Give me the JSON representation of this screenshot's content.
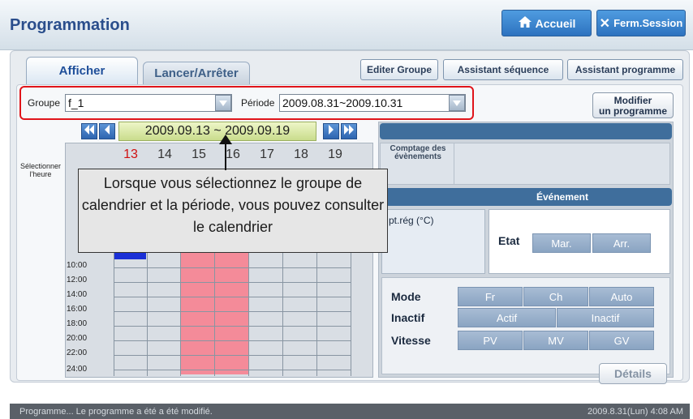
{
  "header": {
    "title": "Programmation",
    "home_label": "Accueil",
    "logout_label": "Ferm.Session"
  },
  "tabs": [
    {
      "label": "Afficher",
      "active": true
    },
    {
      "label": "Lancer/Arrêter",
      "active": false
    }
  ],
  "toolbar": {
    "edit_group": "Editer Groupe",
    "sequence_wizard": "Assistant séquence",
    "program_wizard": "Assistant programme"
  },
  "filter": {
    "group_label": "Groupe",
    "group_value": "f_1",
    "period_label": "Période",
    "period_value": "2009.08.31~2009.10.31",
    "modify_line1": "Modifier",
    "modify_line2": "un programme"
  },
  "calendar": {
    "date_range": "2009.09.13 ~ 2009.09.19",
    "days": [
      "13",
      "14",
      "15",
      "16",
      "17",
      "18",
      "19"
    ],
    "sunday_color": "#d01010",
    "select_time_line1": "Sélectionner",
    "select_time_line2": "l'heure",
    "times": [
      "10:00",
      "12:00",
      "14:00",
      "16:00",
      "18:00",
      "20:00",
      "22:00",
      "24:00"
    ]
  },
  "event_panel": {
    "count_label_line1": "Comptage des",
    "count_label_line2": "évènements",
    "event_header": "Événement",
    "setpoint_label": "pt.rég (°C)",
    "state_label": "Etat",
    "state_on": "Mar.",
    "state_off": "Arr.",
    "mode_label": "Mode",
    "mode_options": [
      "Fr",
      "Ch",
      "Auto"
    ],
    "inactive_label": "Inactif",
    "inactive_options": [
      "Actif",
      "Inactif"
    ],
    "speed_label": "Vitesse",
    "speed_options": [
      "PV",
      "MV",
      "GV"
    ],
    "details_label": "Détails"
  },
  "callout": "Lorsque vous sélectionnez le groupe de calendrier et la période, vous pouvez consulter le calendrier",
  "status": {
    "message": "Programme... Le programme a été a été modifié.",
    "datetime": "2009.8.31(Lun) 4:08 AM"
  },
  "colors": {
    "accent": "#2d72bf",
    "highlight": "#e0141a",
    "scheduled": "#f48b99",
    "event_header": "#3f6e9c"
  }
}
